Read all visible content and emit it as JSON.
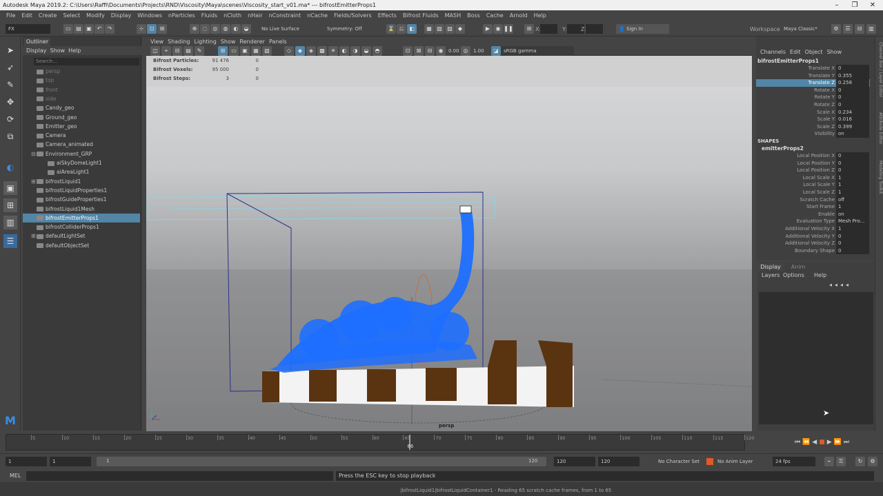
{
  "window": {
    "title": "Autodesk Maya 2019.2: C:\\Users\\Raffi\\Documents\\Projects\\RND\\Viscosity\\Maya\\scenes\\Viscosity_start_v01.ma*   ---   bifrostEmitterProps1",
    "minimize": "–",
    "maximize": "❐",
    "close": "✕"
  },
  "menubar": [
    "File",
    "Edit",
    "Create",
    "Select",
    "Modify",
    "Display",
    "Windows",
    "nParticles",
    "Fluids",
    "nCloth",
    "nHair",
    "nConstraint",
    "nCache",
    "Fields/Solvers",
    "Effects",
    "Bifrost Fluids",
    "MASH",
    "Boss",
    "Cache",
    "Arnold",
    "Help"
  ],
  "statusline": {
    "menuset": "FX",
    "live_surface": "No Live Surface",
    "symmetry": "Symmetry: Off",
    "x_label": "X:",
    "y_label": "Y:",
    "z_label": "Z:",
    "signin": "Sign In",
    "workspace_label": "Workspace :",
    "workspace": "Maya Classic*"
  },
  "outliner": {
    "tab": "Outliner",
    "menu": [
      "Display",
      "Show",
      "Help"
    ],
    "search_placeholder": "Search...",
    "items": [
      {
        "label": "persp",
        "dim": true,
        "indent": 1,
        "exp": ""
      },
      {
        "label": "top",
        "dim": true,
        "indent": 1,
        "exp": ""
      },
      {
        "label": "front",
        "dim": true,
        "indent": 1,
        "exp": ""
      },
      {
        "label": "side",
        "dim": true,
        "indent": 1,
        "exp": ""
      },
      {
        "label": "Candy_geo",
        "dim": false,
        "indent": 1,
        "exp": ""
      },
      {
        "label": "Ground_geo",
        "dim": false,
        "indent": 1,
        "exp": ""
      },
      {
        "label": "Emitter_geo",
        "dim": false,
        "indent": 1,
        "exp": ""
      },
      {
        "label": "Camera",
        "dim": false,
        "indent": 1,
        "exp": ""
      },
      {
        "label": "Camera_animated",
        "dim": false,
        "indent": 1,
        "exp": ""
      },
      {
        "label": "Environment_GRP",
        "dim": false,
        "indent": 1,
        "exp": "⊟"
      },
      {
        "label": "aiSkyDomeLight1",
        "dim": false,
        "indent": 2,
        "exp": ""
      },
      {
        "label": "aiAreaLight1",
        "dim": false,
        "indent": 2,
        "exp": ""
      },
      {
        "label": "bifrostLiquid1",
        "dim": false,
        "indent": 1,
        "exp": "⊞"
      },
      {
        "label": "bifrostLiquidProperties1",
        "dim": false,
        "indent": 1,
        "exp": ""
      },
      {
        "label": "bifrostGuideProperties1",
        "dim": false,
        "indent": 1,
        "exp": ""
      },
      {
        "label": "bifrostLiquid1Mesh",
        "dim": false,
        "indent": 1,
        "exp": ""
      },
      {
        "label": "bifrostEmitterProps1",
        "dim": false,
        "indent": 1,
        "exp": "",
        "selected": true
      },
      {
        "label": "bifrostColliderProps1",
        "dim": false,
        "indent": 1,
        "exp": ""
      },
      {
        "label": "defaultLightSet",
        "dim": false,
        "indent": 1,
        "exp": "⊞"
      },
      {
        "label": "defaultObjectSet",
        "dim": false,
        "indent": 1,
        "exp": ""
      }
    ]
  },
  "viewport": {
    "menu": [
      "View",
      "Shading",
      "Lighting",
      "Show",
      "Renderer",
      "Panels"
    ],
    "exposure": "0.00",
    "gamma": "1.00",
    "colorspace": "sRGB gamma",
    "camera": "persp",
    "hud": [
      {
        "label": "Bifrost Particles:",
        "v1": "91 476",
        "v2": "0"
      },
      {
        "label": "Bifrost Voxels:",
        "v1": "95 000",
        "v2": "0"
      },
      {
        "label": "Bifrost Steps:",
        "v1": "3",
        "v2": "0"
      }
    ]
  },
  "channelbox": {
    "menu": [
      "Channels",
      "Edit",
      "Object",
      "Show"
    ],
    "node": "bifrostEmitterProps1",
    "channels": [
      {
        "name": "Translate X",
        "value": "0"
      },
      {
        "name": "Translate Y",
        "value": "0.355"
      },
      {
        "name": "Translate Z",
        "value": "0.258",
        "hl": true
      },
      {
        "name": "Rotate X",
        "value": "0"
      },
      {
        "name": "Rotate Y",
        "value": "0"
      },
      {
        "name": "Rotate Z",
        "value": "0"
      },
      {
        "name": "Scale X",
        "value": "0.234"
      },
      {
        "name": "Scale Y",
        "value": "0.016"
      },
      {
        "name": "Scale Z",
        "value": "0.399"
      },
      {
        "name": "Visibility",
        "value": "on"
      }
    ],
    "shapes_header": "SHAPES",
    "shape_node": "emitterProps2",
    "shape_channels": [
      {
        "name": "Local Position X",
        "value": "0"
      },
      {
        "name": "Local Position Y",
        "value": "0"
      },
      {
        "name": "Local Position Z",
        "value": "0"
      },
      {
        "name": "Local Scale X",
        "value": "1"
      },
      {
        "name": "Local Scale Y",
        "value": "1"
      },
      {
        "name": "Local Scale Z",
        "value": "1"
      },
      {
        "name": "Scratch Cache",
        "value": "off"
      },
      {
        "name": "Start Frame",
        "value": "1"
      },
      {
        "name": "Enable",
        "value": "on"
      },
      {
        "name": "Evaluation Type",
        "value": "Mesh Pro..."
      },
      {
        "name": "Additional Velocity X",
        "value": "1"
      },
      {
        "name": "Additional Velocity Y",
        "value": "0"
      },
      {
        "name": "Additional Velocity Z",
        "value": "0"
      },
      {
        "name": "Boundary Shape",
        "value": "0"
      }
    ]
  },
  "layers": {
    "tabs": [
      "Display",
      "Anim"
    ],
    "menu": [
      "Layers",
      "Options",
      "Help"
    ]
  },
  "sidebar_tabs": [
    "Channel Box / Layer Editor",
    "Attribute Editor",
    "Modeling Toolkit"
  ],
  "timeline": {
    "ticks": [
      "5",
      "10",
      "15",
      "20",
      "25",
      "30",
      "35",
      "40",
      "45",
      "50",
      "55",
      "60",
      "65",
      "70",
      "75",
      "80",
      "85",
      "90",
      "95",
      "100",
      "105",
      "110",
      "115",
      "120"
    ],
    "current": "66"
  },
  "range": {
    "start": "1",
    "start2": "1",
    "min_label": "1",
    "max_label": "120",
    "end": "120",
    "end2": "120",
    "character_set": "No Character Set",
    "anim_layer": "No Anim Layer",
    "fps": "24 fps"
  },
  "cmdline": {
    "label": "MEL"
  },
  "helpline": {
    "text": "Press the ESC key to stop playback",
    "status": "|bifrostLiquid1|bifrostLiquidContainer1 - Reading 65 scratch cache frames, from 1 to 65"
  },
  "colors": {
    "selection": "#5285a6",
    "fluid": "#1e6fff",
    "panel": "#444444"
  }
}
